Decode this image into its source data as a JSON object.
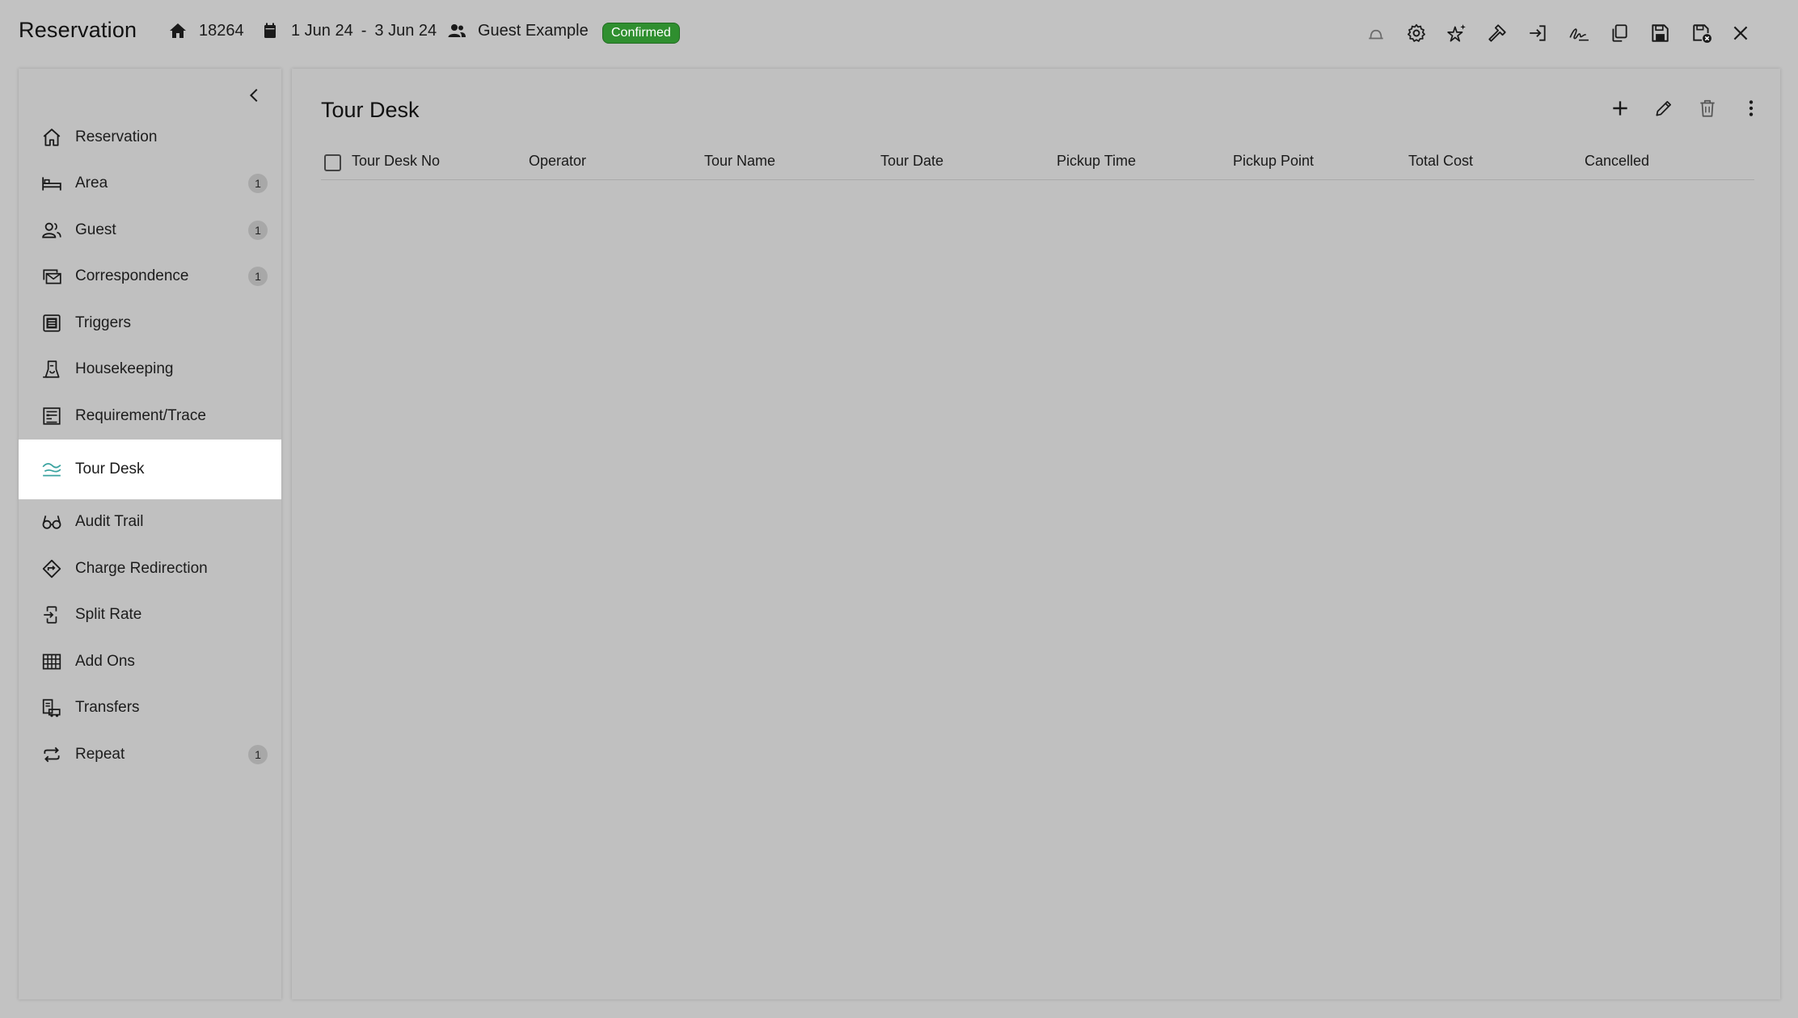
{
  "header": {
    "title": "Reservation",
    "reservation_no": "18264",
    "date_from": "1 Jun 24",
    "date_separator": "-",
    "date_to": "3 Jun 24",
    "guest": "Guest Example",
    "status": "Confirmed",
    "status_color": "#2f8f2f",
    "actions": [
      "bell-icon",
      "gear-icon",
      "stars-icon",
      "hammer-icon",
      "login-icon",
      "signature-icon",
      "copy-icon",
      "save-icon",
      "save-close-icon",
      "close-icon"
    ]
  },
  "sidebar": {
    "items": [
      {
        "label": "Reservation",
        "icon": "home-icon",
        "count": ""
      },
      {
        "label": "Area",
        "icon": "bed-icon",
        "count": "1"
      },
      {
        "label": "Guest",
        "icon": "users-icon",
        "count": "1"
      },
      {
        "label": "Correspondence",
        "icon": "mail-stack-icon",
        "count": "1"
      },
      {
        "label": "Triggers",
        "icon": "list-box-icon",
        "count": ""
      },
      {
        "label": "Housekeeping",
        "icon": "housekeeping-icon",
        "count": ""
      },
      {
        "label": "Requirement/Trace",
        "icon": "checklist-icon",
        "count": ""
      },
      {
        "label": "Tour Desk",
        "icon": "tour-icon",
        "count": "",
        "active": true
      },
      {
        "label": "Audit Trail",
        "icon": "glasses-icon",
        "count": ""
      },
      {
        "label": "Charge Redirection",
        "icon": "diamond-arrow-icon",
        "count": ""
      },
      {
        "label": "Split Rate",
        "icon": "split-icon",
        "count": ""
      },
      {
        "label": "Add Ons",
        "icon": "grid-icon",
        "count": ""
      },
      {
        "label": "Transfers",
        "icon": "transfer-icon",
        "count": ""
      },
      {
        "label": "Repeat",
        "icon": "repeat-icon",
        "count": "1"
      }
    ]
  },
  "main": {
    "title": "Tour Desk",
    "columns": [
      "Tour Desk No",
      "Operator",
      "Tour Name",
      "Tour Date",
      "Pickup Time",
      "Pickup Point",
      "Total Cost",
      "Cancelled"
    ],
    "rows": []
  }
}
